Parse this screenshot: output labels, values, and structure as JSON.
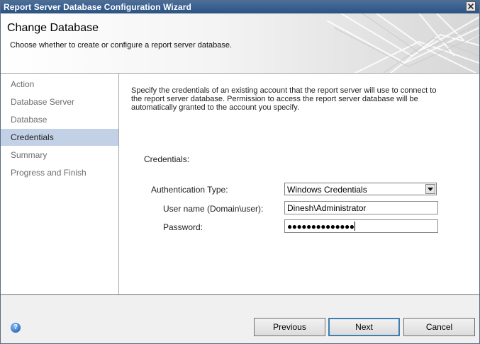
{
  "window": {
    "title": "Report Server Database Configuration Wizard"
  },
  "banner": {
    "title": "Change Database",
    "subtitle": "Choose whether to create or configure a report server database."
  },
  "nav": {
    "items": [
      {
        "label": "Action",
        "selected": false
      },
      {
        "label": "Database Server",
        "selected": false
      },
      {
        "label": "Database",
        "selected": false
      },
      {
        "label": "Credentials",
        "selected": true
      },
      {
        "label": "Summary",
        "selected": false
      },
      {
        "label": "Progress and Finish",
        "selected": false
      }
    ]
  },
  "content": {
    "intro_line1": "Specify the credentials of an existing account that the report server will use to connect to",
    "intro_line2": "the report server database.  Permission to access the report server database will be",
    "intro_line3": "automatically granted to the account you specify.",
    "credentials_heading": "Credentials:",
    "auth_type_label": "Authentication Type:",
    "auth_type_value": "Windows Credentials",
    "username_label": "User name (Domain\\user):",
    "username_value": "Dinesh\\Administrator",
    "password_label": "Password:",
    "password_mask": "●●●●●●●●●●●●●●"
  },
  "footer": {
    "previous_label": "Previous",
    "next_label": "Next",
    "cancel_label": "Cancel",
    "help_glyph": "?"
  },
  "colors": {
    "titlebar": "#2c5282",
    "nav_selected": "#c3d1e6",
    "default_button_border": "#3c7fb1"
  }
}
